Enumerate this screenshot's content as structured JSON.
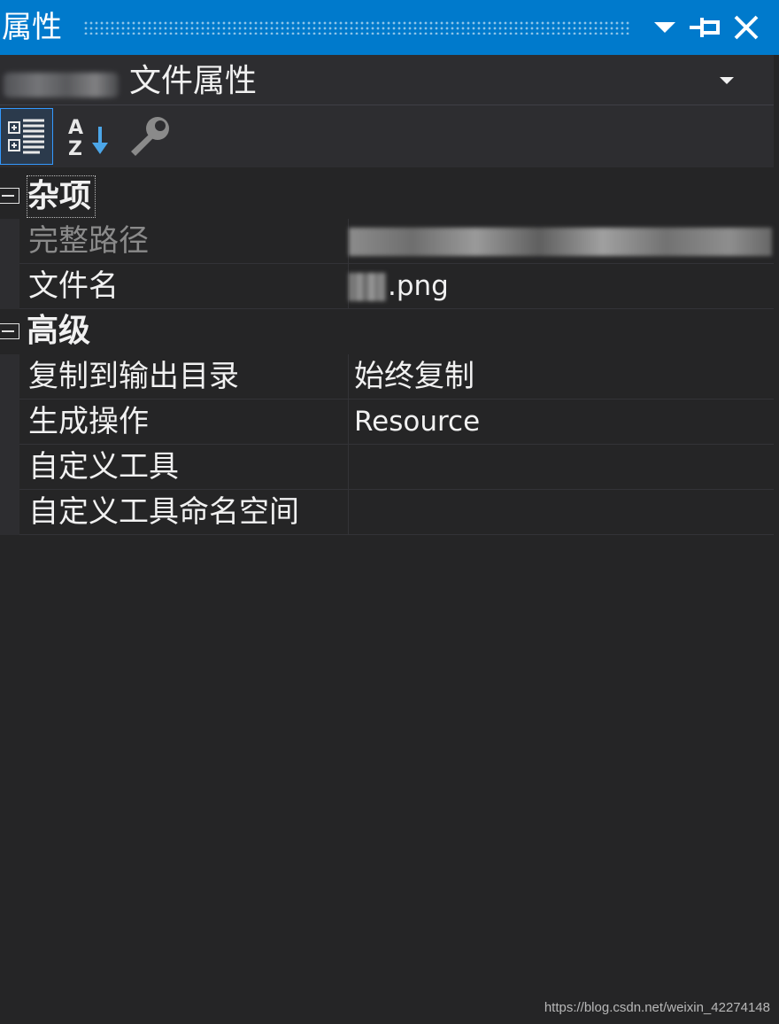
{
  "window": {
    "title": "属性",
    "menu_icon": "dropdown-triangle-icon",
    "pin_icon": "pin-icon",
    "close_icon": "close-icon"
  },
  "selector": {
    "object_type": "文件属性"
  },
  "toolbar": {
    "categorized_icon": "categorized-view-icon",
    "alphabetical_icon": "alphabetical-sort-icon",
    "property_pages_icon": "wrench-icon"
  },
  "categories": [
    {
      "label": "杂项",
      "properties": [
        {
          "name": "完整路径",
          "value": ""
        },
        {
          "name": "文件名",
          "value": ".png"
        }
      ]
    },
    {
      "label": "高级",
      "properties": [
        {
          "name": "复制到输出目录",
          "value": "始终复制"
        },
        {
          "name": "生成操作",
          "value": "Resource"
        },
        {
          "name": "自定义工具",
          "value": ""
        },
        {
          "name": "自定义工具命名空间",
          "value": ""
        }
      ]
    }
  ],
  "watermark": "https://blog.csdn.net/weixin_42274148",
  "colors": {
    "accent": "#007acc",
    "background": "#252526",
    "panel": "#2d2d30",
    "text": "#f1f1f1",
    "dim_text": "#8a8a8a",
    "selection_border": "#3399ff"
  }
}
